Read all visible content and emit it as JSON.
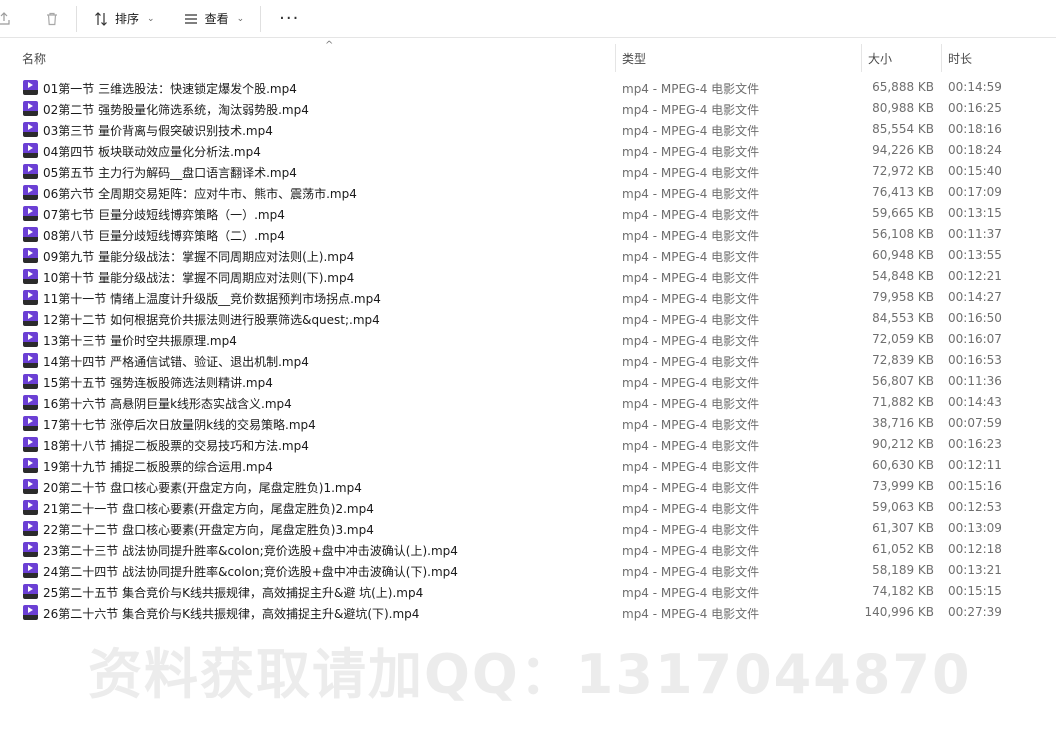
{
  "toolbar": {
    "sort_label": "排序",
    "view_label": "查看",
    "more_label": "···"
  },
  "columns": {
    "name": "名称",
    "type": "类型",
    "size": "大小",
    "duration": "时长"
  },
  "files": [
    {
      "name": "01第一节 三维选股法：快速锁定爆发个股.mp4",
      "type": "mp4 - MPEG-4 电影文件",
      "size": "65,888 KB",
      "duration": "00:14:59"
    },
    {
      "name": "02第二节 强势股量化筛选系统，淘汰弱势股.mp4",
      "type": "mp4 - MPEG-4 电影文件",
      "size": "80,988 KB",
      "duration": "00:16:25"
    },
    {
      "name": "03第三节 量价背离与假突破识别技术.mp4",
      "type": "mp4 - MPEG-4 电影文件",
      "size": "85,554 KB",
      "duration": "00:18:16"
    },
    {
      "name": "04第四节 板块联动效应量化分析法.mp4",
      "type": "mp4 - MPEG-4 电影文件",
      "size": "94,226 KB",
      "duration": "00:18:24"
    },
    {
      "name": "05第五节 主力行为解码__盘口语言翻译术.mp4",
      "type": "mp4 - MPEG-4 电影文件",
      "size": "72,972 KB",
      "duration": "00:15:40"
    },
    {
      "name": "06第六节 全周期交易矩阵：应对牛市、熊市、震荡市.mp4",
      "type": "mp4 - MPEG-4 电影文件",
      "size": "76,413 KB",
      "duration": "00:17:09"
    },
    {
      "name": "07第七节 巨量分歧短线博弈策略（一）.mp4",
      "type": "mp4 - MPEG-4 电影文件",
      "size": "59,665 KB",
      "duration": "00:13:15"
    },
    {
      "name": "08第八节 巨量分歧短线博弈策略（二）.mp4",
      "type": "mp4 - MPEG-4 电影文件",
      "size": "56,108 KB",
      "duration": "00:11:37"
    },
    {
      "name": "09第九节 量能分级战法：掌握不同周期应对法则(上).mp4",
      "type": "mp4 - MPEG-4 电影文件",
      "size": "60,948 KB",
      "duration": "00:13:55"
    },
    {
      "name": "10第十节 量能分级战法：掌握不同周期应对法则(下).mp4",
      "type": "mp4 - MPEG-4 电影文件",
      "size": "54,848 KB",
      "duration": "00:12:21"
    },
    {
      "name": "11第十一节 情绪上温度计升级版__竞价数据预判市场拐点.mp4",
      "type": "mp4 - MPEG-4 电影文件",
      "size": "79,958 KB",
      "duration": "00:14:27"
    },
    {
      "name": "12第十二节 如何根据竞价共振法则进行股票筛选&quest;.mp4",
      "type": "mp4 - MPEG-4 电影文件",
      "size": "84,553 KB",
      "duration": "00:16:50"
    },
    {
      "name": "13第十三节 量价时空共振原理.mp4",
      "type": "mp4 - MPEG-4 电影文件",
      "size": "72,059 KB",
      "duration": "00:16:07"
    },
    {
      "name": "14第十四节 严格通信试错、验证、退出机制.mp4",
      "type": "mp4 - MPEG-4 电影文件",
      "size": "72,839 KB",
      "duration": "00:16:53"
    },
    {
      "name": "15第十五节 强势连板股筛选法则精讲.mp4",
      "type": "mp4 - MPEG-4 电影文件",
      "size": "56,807 KB",
      "duration": "00:11:36"
    },
    {
      "name": "16第十六节 高悬阴巨量k线形态实战含义.mp4",
      "type": "mp4 - MPEG-4 电影文件",
      "size": "71,882 KB",
      "duration": "00:14:43"
    },
    {
      "name": "17第十七节 涨停后次日放量阴k线的交易策略.mp4",
      "type": "mp4 - MPEG-4 电影文件",
      "size": "38,716 KB",
      "duration": "00:07:59"
    },
    {
      "name": "18第十八节 捕捉二板股票的交易技巧和方法.mp4",
      "type": "mp4 - MPEG-4 电影文件",
      "size": "90,212 KB",
      "duration": "00:16:23"
    },
    {
      "name": "19第十九节 捕捉二板股票的综合运用.mp4",
      "type": "mp4 - MPEG-4 电影文件",
      "size": "60,630 KB",
      "duration": "00:12:11"
    },
    {
      "name": "20第二十节 盘口核心要素(开盘定方向，尾盘定胜负)1.mp4",
      "type": "mp4 - MPEG-4 电影文件",
      "size": "73,999 KB",
      "duration": "00:15:16"
    },
    {
      "name": "21第二十一节 盘口核心要素(开盘定方向，尾盘定胜负)2.mp4",
      "type": "mp4 - MPEG-4 电影文件",
      "size": "59,063 KB",
      "duration": "00:12:53"
    },
    {
      "name": "22第二十二节 盘口核心要素(开盘定方向，尾盘定胜负)3.mp4",
      "type": "mp4 - MPEG-4 电影文件",
      "size": "61,307 KB",
      "duration": "00:13:09"
    },
    {
      "name": "23第二十三节 战法协同提升胜率&colon;竞价选股+盘中冲击波确认(上).mp4",
      "type": "mp4 - MPEG-4 电影文件",
      "size": "61,052 KB",
      "duration": "00:12:18"
    },
    {
      "name": "24第二十四节 战法协同提升胜率&colon;竞价选股+盘中冲击波确认(下).mp4",
      "type": "mp4 - MPEG-4 电影文件",
      "size": "58,189 KB",
      "duration": "00:13:21"
    },
    {
      "name": "25第二十五节 集合竞价与K线共振规律，高效捕捉主升&避 坑(上).mp4",
      "type": "mp4 - MPEG-4 电影文件",
      "size": "74,182 KB",
      "duration": "00:15:15"
    },
    {
      "name": "26第二十六节 集合竞价与K线共振规律，高效捕捉主升&避坑(下).mp4",
      "type": "mp4 - MPEG-4 电影文件",
      "size": "140,996 KB",
      "duration": "00:27:39"
    }
  ],
  "watermark": "资料获取请加QQ：1317044870",
  "colors": {
    "accent_icon": "#6b3fd4",
    "secondary_text": "#6e6e6e",
    "watermark": "#ececec"
  }
}
